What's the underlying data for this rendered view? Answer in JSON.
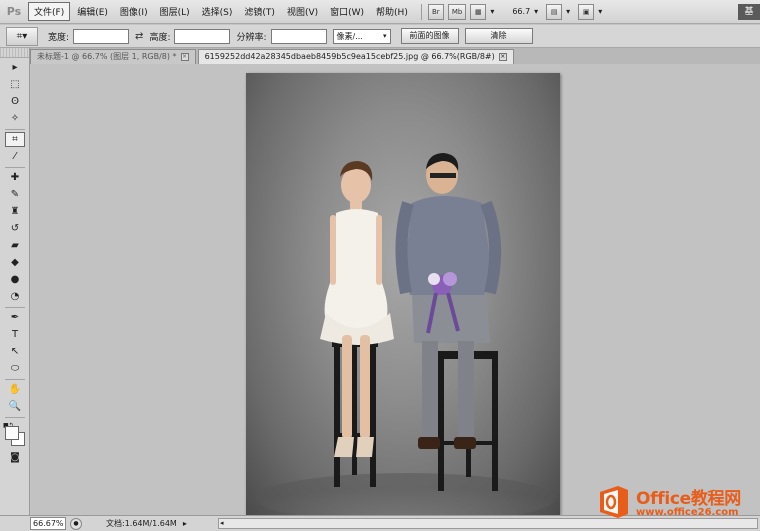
{
  "app": {
    "logo": "Ps",
    "workspace_button": "基"
  },
  "menu": {
    "items": [
      {
        "label": "文件(F)",
        "active": true
      },
      {
        "label": "编辑(E)"
      },
      {
        "label": "图像(I)"
      },
      {
        "label": "图层(L)"
      },
      {
        "label": "选择(S)"
      },
      {
        "label": "滤镜(T)"
      },
      {
        "label": "视图(V)"
      },
      {
        "label": "窗口(W)"
      },
      {
        "label": "帮助(H)"
      }
    ],
    "bridge_label": "Br",
    "minibridge_label": "Mb",
    "zoom_value": "66.7",
    "dropdown_arrow": "▾"
  },
  "options": {
    "width_label": "宽度:",
    "width_value": "",
    "swap_glyph": "⇄",
    "height_label": "高度:",
    "height_value": "",
    "resolution_label": "分辨率:",
    "resolution_value": "",
    "unit_value": "像素/...",
    "front_image_button": "前面的图像",
    "clear_button": "清除"
  },
  "tabs": [
    {
      "label": "未标题-1 @ 66.7% (图层 1, RGB/8) *",
      "active": false
    },
    {
      "label": "6159252dd42a28345dbaeb8459b5c9ea15cebf25.jpg @ 66.7%(RGB/8#)",
      "active": true
    }
  ],
  "tools": [
    {
      "name": "move-tool-icon",
      "glyph": "▸"
    },
    {
      "name": "marquee-tool-icon",
      "glyph": "⬚"
    },
    {
      "name": "lasso-tool-icon",
      "glyph": "ʘ"
    },
    {
      "name": "quick-select-tool-icon",
      "glyph": "✧"
    },
    {
      "name": "crop-tool-icon",
      "glyph": "⌗",
      "active": true
    },
    {
      "name": "eyedropper-tool-icon",
      "glyph": "⁄"
    },
    {
      "name": "healing-brush-tool-icon",
      "glyph": "✚"
    },
    {
      "name": "brush-tool-icon",
      "glyph": "✎"
    },
    {
      "name": "clone-stamp-tool-icon",
      "glyph": "♜"
    },
    {
      "name": "history-brush-tool-icon",
      "glyph": "↺"
    },
    {
      "name": "eraser-tool-icon",
      "glyph": "▰"
    },
    {
      "name": "paint-bucket-tool-icon",
      "glyph": "◆"
    },
    {
      "name": "blur-tool-icon",
      "glyph": "●"
    },
    {
      "name": "dodge-tool-icon",
      "glyph": "◔"
    },
    {
      "name": "pen-tool-icon",
      "glyph": "✒"
    },
    {
      "name": "type-tool-icon",
      "glyph": "T"
    },
    {
      "name": "path-select-tool-icon",
      "glyph": "↖"
    },
    {
      "name": "ellipse-tool-icon",
      "glyph": "⬭"
    },
    {
      "name": "hand-tool-icon",
      "glyph": "✋"
    },
    {
      "name": "zoom-tool-icon",
      "glyph": "🔍"
    }
  ],
  "status": {
    "zoom": "66.67%",
    "doc_size": "文档:1.64M/1.64M",
    "arrow": "▸",
    "scroll_left": "◂"
  },
  "watermark": {
    "title": "Office教程网",
    "url": "www.office26.com",
    "brand_color": "#e85d1a"
  }
}
